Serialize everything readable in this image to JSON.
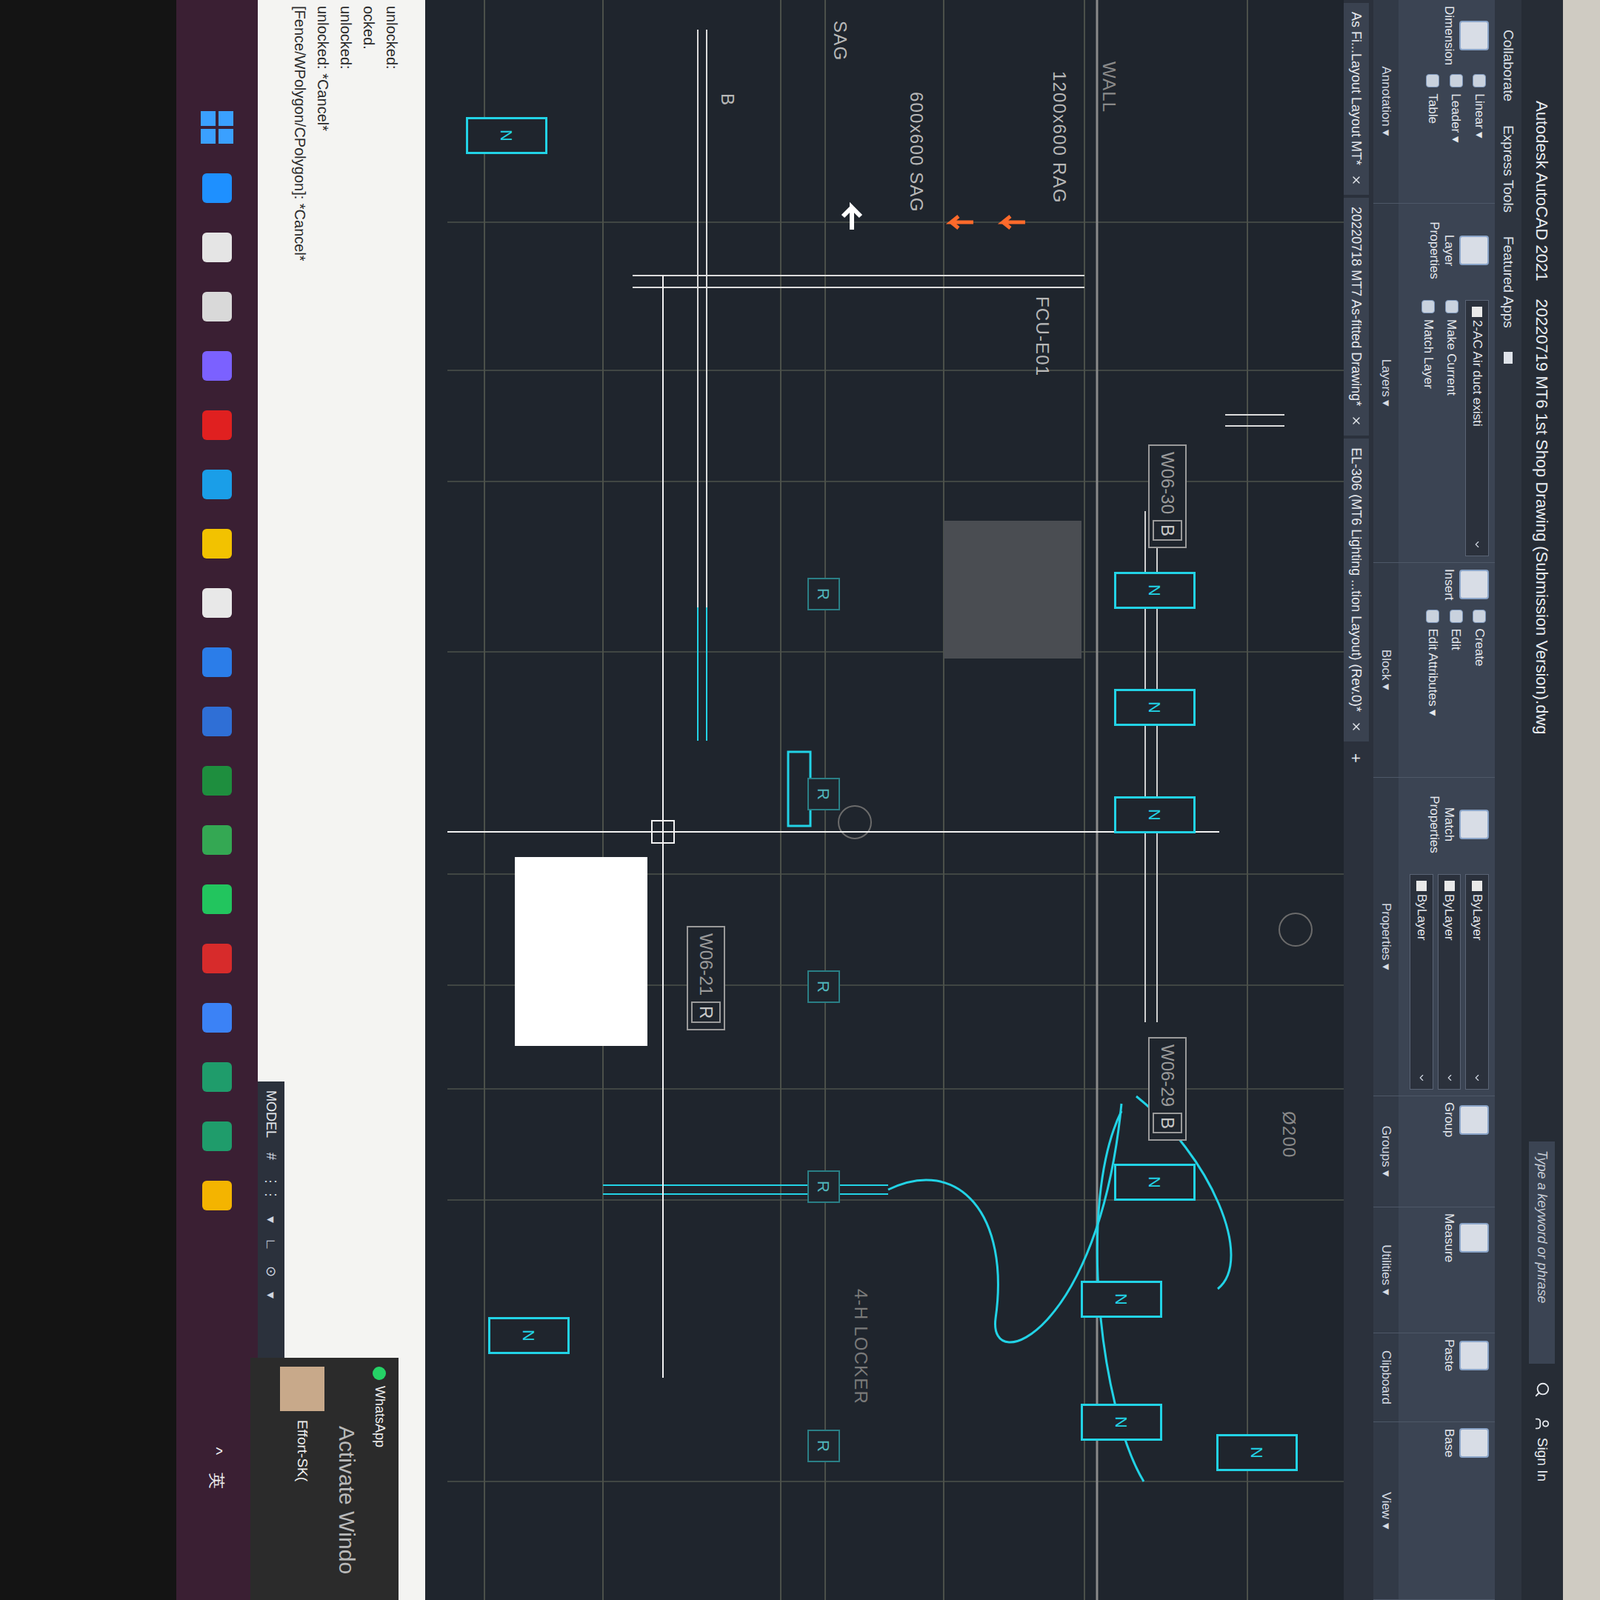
{
  "window": {
    "app": "Autodesk AutoCAD 2021",
    "title": "20220719 MT6 1st Shop Drawing (Submission Version).dwg",
    "search_placeholder": "Type a keyword or phrase",
    "sign_in": "Sign In"
  },
  "ribbon_tabs": [
    {
      "label": "Collaborate",
      "selected": false
    },
    {
      "label": "Express Tools",
      "selected": false
    },
    {
      "label": "Featured Apps",
      "selected": false
    }
  ],
  "ribbon_panels": [
    {
      "label": "Annotation ▾",
      "items": [
        {
          "label": "Dimension",
          "kind": "large"
        },
        {
          "label": "Linear ▾",
          "kind": "small"
        },
        {
          "label": "Leader ▾",
          "kind": "small"
        },
        {
          "label": "Table",
          "kind": "small"
        }
      ]
    },
    {
      "label": "Layers ▾",
      "items": [
        {
          "label": "Layer Properties",
          "kind": "large"
        },
        {
          "label": "2-AC Air duct existi",
          "kind": "combo"
        },
        {
          "label": "Make Current",
          "kind": "small"
        },
        {
          "label": "Match Layer",
          "kind": "small"
        }
      ]
    },
    {
      "label": "Block ▾",
      "items": [
        {
          "label": "Insert",
          "kind": "large"
        },
        {
          "label": "Create",
          "kind": "small"
        },
        {
          "label": "Edit",
          "kind": "small"
        },
        {
          "label": "Edit Attributes ▾",
          "kind": "small"
        }
      ]
    },
    {
      "label": "Properties ▾",
      "items": [
        {
          "label": "Match Properties",
          "kind": "large"
        },
        {
          "label": "ByLayer",
          "kind": "combo"
        },
        {
          "label": "ByLayer",
          "kind": "combo"
        },
        {
          "label": "ByLayer",
          "kind": "combo"
        }
      ]
    },
    {
      "label": "Groups ▾",
      "items": [
        {
          "label": "Group",
          "kind": "large"
        }
      ]
    },
    {
      "label": "Utilities ▾",
      "items": [
        {
          "label": "Measure",
          "kind": "large"
        }
      ]
    },
    {
      "label": "Clipboard",
      "items": [
        {
          "label": "Paste",
          "kind": "large"
        }
      ]
    },
    {
      "label": "View ▾",
      "items": [
        {
          "label": "Base",
          "kind": "large"
        }
      ]
    }
  ],
  "file_tabs": [
    {
      "label": "As Fi...Layout Layout MT*",
      "selected": false
    },
    {
      "label": "20220718 MT7 As-fitted Drawing*",
      "selected": false
    },
    {
      "label": "EL-306 (MT6 Lighting ...tion Layout) (Rev.0)*",
      "selected": false
    }
  ],
  "new_tab": "+",
  "drawing": {
    "labels": [
      {
        "text": "WALL",
        "color": "#8a8a8a"
      },
      {
        "text": "1200x600 RAG",
        "color": "#b8b8b8"
      },
      {
        "text": "600x600 SAG",
        "color": "#b8b8b8"
      },
      {
        "text": "SAG",
        "color": "#b8b8b8"
      },
      {
        "text": "FCU-E01",
        "color": "#b8b8b8"
      },
      {
        "text": "Ø200",
        "color": "#8a8a8a"
      },
      {
        "text": "4-H LOCKER",
        "color": "#7a7a7a"
      },
      {
        "text": "B",
        "color": "#b8b8b8"
      }
    ],
    "duct_tags": [
      {
        "code": "W06-30",
        "letter": "B"
      },
      {
        "code": "W06-29",
        "letter": "B"
      },
      {
        "code": "W06-21",
        "letter": "R"
      }
    ],
    "fixtures": [
      "N",
      "N",
      "N",
      "N",
      "N",
      "N",
      "N",
      "N",
      "N"
    ],
    "room_tags": [
      "R",
      "R",
      "R",
      "R",
      "R"
    ]
  },
  "command_line": {
    "history": [
      "unlocked:",
      "ocked.",
      "unlocked:",
      "unlocked: *Cancel*",
      "[Fence/WPolygon/CPolygon]: *Cancel*"
    ]
  },
  "status_bar": {
    "mode": "MODEL",
    "icons": [
      "#",
      "⋮⋮",
      "▾",
      "∟",
      "⊙",
      "▾"
    ]
  },
  "taskbar": {
    "apps": [
      {
        "color": "#1e90ff"
      },
      {
        "color": "#e5e5e5"
      },
      {
        "color": "#d9d9d9"
      },
      {
        "color": "#7b61ff"
      },
      {
        "color": "#e02020"
      },
      {
        "color": "#1a9ee8"
      },
      {
        "color": "#f2c200"
      },
      {
        "color": "#e8e8e8"
      },
      {
        "color": "#2b7de9"
      },
      {
        "color": "#2f6fd6"
      },
      {
        "color": "#1e8e3e"
      },
      {
        "color": "#34a853"
      },
      {
        "color": "#22c55e"
      },
      {
        "color": "#d72b2b"
      },
      {
        "color": "#3b82f6"
      },
      {
        "color": "#1f9c6b"
      },
      {
        "color": "#1f9c6b"
      },
      {
        "color": "#f4b400"
      }
    ],
    "tray": [
      "^",
      "英"
    ]
  },
  "notification": {
    "app": "WhatsApp",
    "sender": "Effort-SK("
  },
  "watermark": "Activate Windo"
}
